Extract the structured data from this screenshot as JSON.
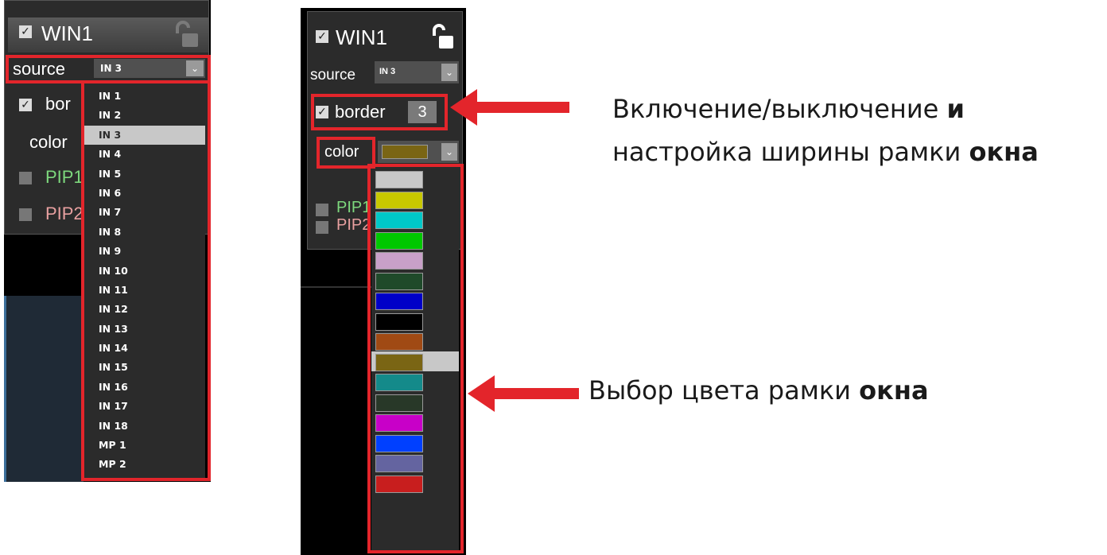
{
  "left": {
    "window_label": "WIN1",
    "source_label": "source",
    "source_value": "IN 3",
    "border_label": "bor",
    "color_label": "color",
    "pip1_label": "PIP1",
    "pip2_label": "PIP2",
    "source_options": [
      "IN 1",
      "IN 2",
      "IN 3",
      "IN 4",
      "IN 5",
      "IN 6",
      "IN 7",
      "IN 8",
      "IN 9",
      "IN 10",
      "IN 11",
      "IN 12",
      "IN 13",
      "IN 14",
      "IN 15",
      "IN 16",
      "IN 17",
      "IN 18",
      "MP 1",
      "MP 2"
    ],
    "selected_index": 2
  },
  "right": {
    "window_label": "WIN1",
    "source_label": "source",
    "source_value": "IN 3",
    "border_label": "border",
    "border_width": "3",
    "color_label": "color",
    "color_value": "#7a6514",
    "pip1_label": "PIP1",
    "pip2_label": "PIP2",
    "color_options": [
      "#c8c8c8",
      "#c8c800",
      "#00c8c8",
      "#00c800",
      "#c8a0c8",
      "#1f4a2a",
      "#0000c8",
      "#000000",
      "#a04a14",
      "#7a6514",
      "#148a8a",
      "#283828",
      "#c800c8",
      "#0040ff",
      "#6464a0",
      "#c81e1e"
    ],
    "selected_color_index": 9
  },
  "annotations": {
    "border_line1_a": "Включение/выключение ",
    "border_line1_b": "и",
    "border_line2_a": "настройка ширины рамки ",
    "border_line2_b": "окна",
    "color_a": "Выбор цвета рамки ",
    "color_b": "окна"
  },
  "colors": {
    "accent_red": "#e3252b",
    "pip1": "#7dd87d",
    "pip2": "#e8a0a0"
  }
}
